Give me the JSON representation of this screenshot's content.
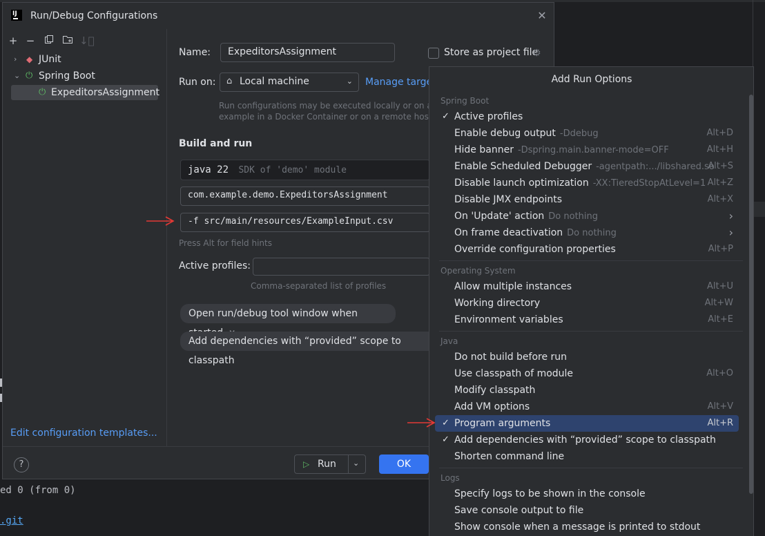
{
  "background": {
    "console_line": "ed 0 (from 0)",
    "link_text": ".git"
  },
  "dialog": {
    "title": "Run/Debug Configurations",
    "toolbar_icons": [
      "plus-icon",
      "minus-icon",
      "copy-icon",
      "folder-icon",
      "sort-icon"
    ],
    "tree": {
      "junit": "JUnit",
      "spring_boot": "Spring Boot",
      "config": "ExpeditorsAssignment"
    },
    "edit_templates": "Edit configuration templates...",
    "name_label": "Name:",
    "name_value": "ExpeditorsAssignment",
    "store_label": "Store as project file",
    "run_on_label": "Run on:",
    "run_on_value": "Local machine",
    "manage_targets": "Manage target",
    "run_on_hint_1": "Run configurations may be executed locally or on a targ",
    "run_on_hint_2": "example in a Docker Container or on a remote host usin",
    "build_run_title": "Build and run",
    "jdk_value": "java 22",
    "jdk_hint": "SDK of 'demo' module",
    "main_class": "com.example.demo.ExpeditorsAssignment",
    "program_args": "-f src/main/resources/ExampleInput.csv",
    "field_hint": "Press Alt for field hints",
    "active_profiles_label": "Active profiles:",
    "active_profiles_value": "",
    "profiles_hint": "Comma-separated list of profiles",
    "chip_1": "Open run/debug tool window when started",
    "chip_2": "Add dependencies with “provided” scope to classpath",
    "help": "?",
    "run_button": "Run",
    "ok_button": "OK"
  },
  "popup": {
    "title": "Add Run Options",
    "sections": {
      "spring_boot": "Spring Boot",
      "os": "Operating System",
      "java": "Java",
      "logs": "Logs"
    },
    "items": [
      {
        "label": "Active profiles",
        "extra": "",
        "shortcut": "",
        "checked": true
      },
      {
        "label": "Enable debug output",
        "extra": "-Ddebug",
        "shortcut": "Alt+D",
        "checked": false
      },
      {
        "label": "Hide banner",
        "extra": "-Dspring.main.banner-mode=OFF",
        "shortcut": "Alt+H",
        "checked": false
      },
      {
        "label": "Enable Scheduled Debugger",
        "extra": "-agentpath:.../libshared.so",
        "shortcut": "Alt+S",
        "checked": false
      },
      {
        "label": "Disable launch optimization",
        "extra": "-XX:TieredStopAtLevel=1",
        "shortcut": "Alt+Z",
        "checked": false
      },
      {
        "label": "Disable JMX endpoints",
        "extra": "",
        "shortcut": "Alt+X",
        "checked": false
      },
      {
        "label": "On 'Update' action",
        "extra": "Do nothing",
        "shortcut": "",
        "checked": false
      },
      {
        "label": "On frame deactivation",
        "extra": "Do nothing",
        "shortcut": "",
        "checked": false
      },
      {
        "label": "Override configuration properties",
        "extra": "",
        "shortcut": "Alt+P",
        "checked": false
      },
      {
        "label": "Allow multiple instances",
        "extra": "",
        "shortcut": "Alt+U",
        "checked": false
      },
      {
        "label": "Working directory",
        "extra": "",
        "shortcut": "Alt+W",
        "checked": false
      },
      {
        "label": "Environment variables",
        "extra": "",
        "shortcut": "Alt+E",
        "checked": false
      },
      {
        "label": "Do not build before run",
        "extra": "",
        "shortcut": "",
        "checked": false
      },
      {
        "label": "Use classpath of module",
        "extra": "",
        "shortcut": "Alt+O",
        "checked": false
      },
      {
        "label": "Modify classpath",
        "extra": "",
        "shortcut": "",
        "checked": false
      },
      {
        "label": "Add VM options",
        "extra": "",
        "shortcut": "Alt+V",
        "checked": false
      },
      {
        "label": "Program arguments",
        "extra": "",
        "shortcut": "Alt+R",
        "checked": true
      },
      {
        "label": "Add dependencies with “provided” scope to classpath",
        "extra": "",
        "shortcut": "",
        "checked": true
      },
      {
        "label": "Shorten command line",
        "extra": "",
        "shortcut": "",
        "checked": false
      },
      {
        "label": "Specify logs to be shown in the console",
        "extra": "",
        "shortcut": "",
        "checked": false
      },
      {
        "label": "Save console output to file",
        "extra": "",
        "shortcut": "",
        "checked": false
      },
      {
        "label": "Show console when a message is printed to stdout",
        "extra": "",
        "shortcut": "",
        "checked": false
      }
    ]
  },
  "colors": {
    "accent": "#3574f0",
    "highlight": "#2e436e",
    "annotation_arrow": "#e53935"
  }
}
